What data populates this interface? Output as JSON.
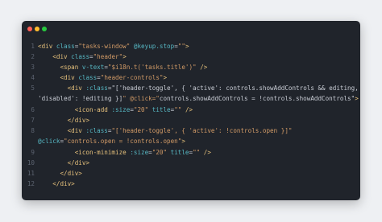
{
  "window": {
    "title_dots": [
      "close",
      "minimize",
      "zoom"
    ]
  },
  "code": {
    "lines": [
      {
        "number": "1",
        "text": "<div class=\"tasks-window\" @keyup.stop=\"\">"
      },
      {
        "number": "2",
        "text": "    <div class=\"header\">"
      },
      {
        "number": "3",
        "text": "      <span v-text=\"$i18n.t('tasks.title')\" />"
      },
      {
        "number": "4",
        "text": "      <div class=\"header-controls\">"
      },
      {
        "number": "5",
        "text": "        <div :class=\"['header-toggle', { 'active': controls.showAddControls && editing,"
      },
      {
        "number": "",
        "text": "'disabled': !editing }]\" @click=\"controls.showAddControls = !controls.showAddControls\">"
      },
      {
        "number": "6",
        "text": "          <icon-add :size=\"20\" title=\"\" />"
      },
      {
        "number": "7",
        "text": "        </div>"
      },
      {
        "number": "8",
        "text": "        <div :class=\"['header-toggle', { 'active': !controls.open }]\""
      },
      {
        "number": "",
        "text": "@click=\"controls.open = !controls.open\">"
      },
      {
        "number": "9",
        "text": "          <icon-minimize :size=\"20\" title=\"\" />"
      },
      {
        "number": "10",
        "text": "        </div>"
      },
      {
        "number": "11",
        "text": "      </div>"
      },
      {
        "number": "12",
        "text": "    </div>"
      }
    ]
  },
  "colors": {
    "background": "#eef0f3",
    "editor": "#20242b",
    "tag": "#e5c07b",
    "attr": "#56b6c2",
    "string": "#d19a66",
    "line_number": "#5c6370"
  }
}
